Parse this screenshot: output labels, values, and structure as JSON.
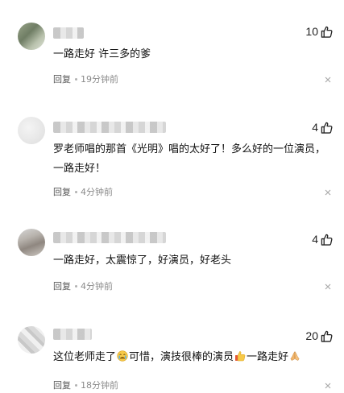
{
  "comments": [
    {
      "likes": "10",
      "text": "一路走好 许三多的爹",
      "reply_label": "回复",
      "time": "19分钟前"
    },
    {
      "likes": "4",
      "text": "罗老师唱的那首《光明》唱的太好了！多么好的一位演员，一路走好！",
      "reply_label": "回复",
      "time": "4分钟前"
    },
    {
      "likes": "4",
      "text": "一路走好，太震惊了，好演员，好老头",
      "reply_label": "回复",
      "time": "4分钟前"
    },
    {
      "likes": "20",
      "text_part1": "这位老师走了",
      "text_part2": "可惜，演技很棒的演员",
      "text_part3": "一路走好",
      "emoji1": "crying-emoji",
      "emoji2": "thumbs-up-emoji",
      "emoji3": "praying-hands-emoji",
      "reply_label": "回复",
      "time": "18分钟前"
    }
  ],
  "icons": {
    "like": "thumbs-up-outline-icon",
    "close": "close-icon"
  },
  "colors": {
    "text": "#111111",
    "meta": "#8a8a8a",
    "icon": "#222222"
  }
}
